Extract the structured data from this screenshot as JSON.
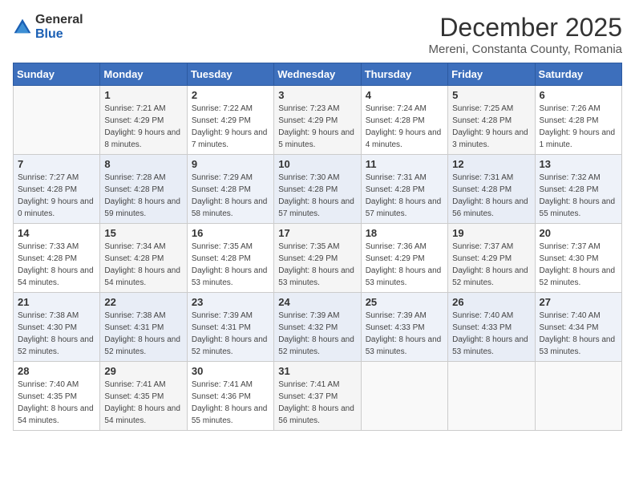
{
  "header": {
    "logo": {
      "general": "General",
      "blue": "Blue"
    },
    "title": "December 2025",
    "location": "Mereni, Constanta County, Romania"
  },
  "calendar": {
    "headers": [
      "Sunday",
      "Monday",
      "Tuesday",
      "Wednesday",
      "Thursday",
      "Friday",
      "Saturday"
    ],
    "weeks": [
      [
        {
          "day": "",
          "sunrise": "",
          "sunset": "",
          "daylight": "",
          "empty": true
        },
        {
          "day": "1",
          "sunrise": "Sunrise: 7:21 AM",
          "sunset": "Sunset: 4:29 PM",
          "daylight": "Daylight: 9 hours and 8 minutes."
        },
        {
          "day": "2",
          "sunrise": "Sunrise: 7:22 AM",
          "sunset": "Sunset: 4:29 PM",
          "daylight": "Daylight: 9 hours and 7 minutes."
        },
        {
          "day": "3",
          "sunrise": "Sunrise: 7:23 AM",
          "sunset": "Sunset: 4:29 PM",
          "daylight": "Daylight: 9 hours and 5 minutes."
        },
        {
          "day": "4",
          "sunrise": "Sunrise: 7:24 AM",
          "sunset": "Sunset: 4:28 PM",
          "daylight": "Daylight: 9 hours and 4 minutes."
        },
        {
          "day": "5",
          "sunrise": "Sunrise: 7:25 AM",
          "sunset": "Sunset: 4:28 PM",
          "daylight": "Daylight: 9 hours and 3 minutes."
        },
        {
          "day": "6",
          "sunrise": "Sunrise: 7:26 AM",
          "sunset": "Sunset: 4:28 PM",
          "daylight": "Daylight: 9 hours and 1 minute."
        }
      ],
      [
        {
          "day": "7",
          "sunrise": "Sunrise: 7:27 AM",
          "sunset": "Sunset: 4:28 PM",
          "daylight": "Daylight: 9 hours and 0 minutes."
        },
        {
          "day": "8",
          "sunrise": "Sunrise: 7:28 AM",
          "sunset": "Sunset: 4:28 PM",
          "daylight": "Daylight: 8 hours and 59 minutes."
        },
        {
          "day": "9",
          "sunrise": "Sunrise: 7:29 AM",
          "sunset": "Sunset: 4:28 PM",
          "daylight": "Daylight: 8 hours and 58 minutes."
        },
        {
          "day": "10",
          "sunrise": "Sunrise: 7:30 AM",
          "sunset": "Sunset: 4:28 PM",
          "daylight": "Daylight: 8 hours and 57 minutes."
        },
        {
          "day": "11",
          "sunrise": "Sunrise: 7:31 AM",
          "sunset": "Sunset: 4:28 PM",
          "daylight": "Daylight: 8 hours and 57 minutes."
        },
        {
          "day": "12",
          "sunrise": "Sunrise: 7:31 AM",
          "sunset": "Sunset: 4:28 PM",
          "daylight": "Daylight: 8 hours and 56 minutes."
        },
        {
          "day": "13",
          "sunrise": "Sunrise: 7:32 AM",
          "sunset": "Sunset: 4:28 PM",
          "daylight": "Daylight: 8 hours and 55 minutes."
        }
      ],
      [
        {
          "day": "14",
          "sunrise": "Sunrise: 7:33 AM",
          "sunset": "Sunset: 4:28 PM",
          "daylight": "Daylight: 8 hours and 54 minutes."
        },
        {
          "day": "15",
          "sunrise": "Sunrise: 7:34 AM",
          "sunset": "Sunset: 4:28 PM",
          "daylight": "Daylight: 8 hours and 54 minutes."
        },
        {
          "day": "16",
          "sunrise": "Sunrise: 7:35 AM",
          "sunset": "Sunset: 4:28 PM",
          "daylight": "Daylight: 8 hours and 53 minutes."
        },
        {
          "day": "17",
          "sunrise": "Sunrise: 7:35 AM",
          "sunset": "Sunset: 4:29 PM",
          "daylight": "Daylight: 8 hours and 53 minutes."
        },
        {
          "day": "18",
          "sunrise": "Sunrise: 7:36 AM",
          "sunset": "Sunset: 4:29 PM",
          "daylight": "Daylight: 8 hours and 53 minutes."
        },
        {
          "day": "19",
          "sunrise": "Sunrise: 7:37 AM",
          "sunset": "Sunset: 4:29 PM",
          "daylight": "Daylight: 8 hours and 52 minutes."
        },
        {
          "day": "20",
          "sunrise": "Sunrise: 7:37 AM",
          "sunset": "Sunset: 4:30 PM",
          "daylight": "Daylight: 8 hours and 52 minutes."
        }
      ],
      [
        {
          "day": "21",
          "sunrise": "Sunrise: 7:38 AM",
          "sunset": "Sunset: 4:30 PM",
          "daylight": "Daylight: 8 hours and 52 minutes."
        },
        {
          "day": "22",
          "sunrise": "Sunrise: 7:38 AM",
          "sunset": "Sunset: 4:31 PM",
          "daylight": "Daylight: 8 hours and 52 minutes."
        },
        {
          "day": "23",
          "sunrise": "Sunrise: 7:39 AM",
          "sunset": "Sunset: 4:31 PM",
          "daylight": "Daylight: 8 hours and 52 minutes."
        },
        {
          "day": "24",
          "sunrise": "Sunrise: 7:39 AM",
          "sunset": "Sunset: 4:32 PM",
          "daylight": "Daylight: 8 hours and 52 minutes."
        },
        {
          "day": "25",
          "sunrise": "Sunrise: 7:39 AM",
          "sunset": "Sunset: 4:33 PM",
          "daylight": "Daylight: 8 hours and 53 minutes."
        },
        {
          "day": "26",
          "sunrise": "Sunrise: 7:40 AM",
          "sunset": "Sunset: 4:33 PM",
          "daylight": "Daylight: 8 hours and 53 minutes."
        },
        {
          "day": "27",
          "sunrise": "Sunrise: 7:40 AM",
          "sunset": "Sunset: 4:34 PM",
          "daylight": "Daylight: 8 hours and 53 minutes."
        }
      ],
      [
        {
          "day": "28",
          "sunrise": "Sunrise: 7:40 AM",
          "sunset": "Sunset: 4:35 PM",
          "daylight": "Daylight: 8 hours and 54 minutes."
        },
        {
          "day": "29",
          "sunrise": "Sunrise: 7:41 AM",
          "sunset": "Sunset: 4:35 PM",
          "daylight": "Daylight: 8 hours and 54 minutes."
        },
        {
          "day": "30",
          "sunrise": "Sunrise: 7:41 AM",
          "sunset": "Sunset: 4:36 PM",
          "daylight": "Daylight: 8 hours and 55 minutes."
        },
        {
          "day": "31",
          "sunrise": "Sunrise: 7:41 AM",
          "sunset": "Sunset: 4:37 PM",
          "daylight": "Daylight: 8 hours and 56 minutes."
        },
        {
          "day": "",
          "sunrise": "",
          "sunset": "",
          "daylight": "",
          "empty": true
        },
        {
          "day": "",
          "sunrise": "",
          "sunset": "",
          "daylight": "",
          "empty": true
        },
        {
          "day": "",
          "sunrise": "",
          "sunset": "",
          "daylight": "",
          "empty": true
        }
      ]
    ]
  }
}
